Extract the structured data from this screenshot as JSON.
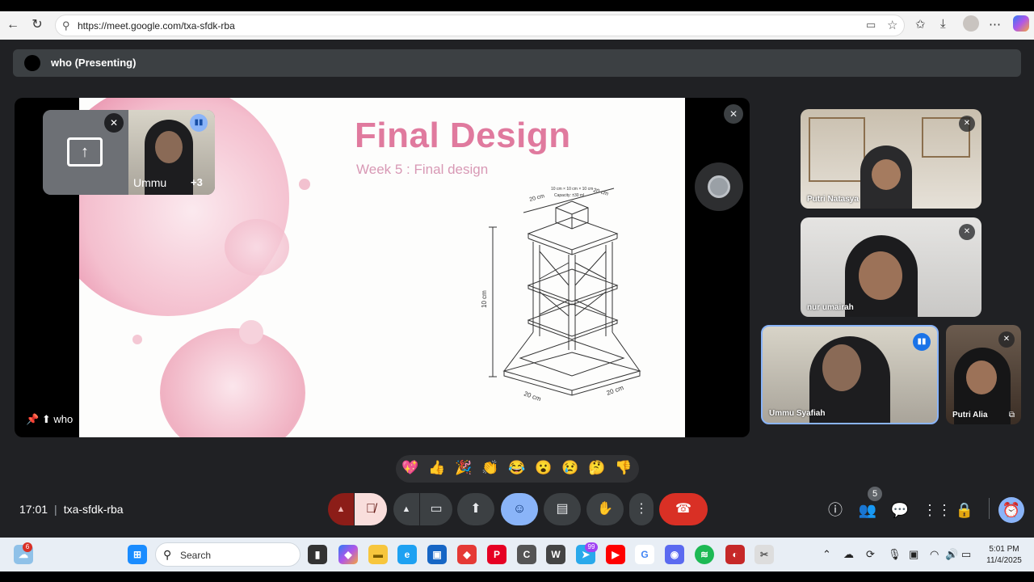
{
  "browser": {
    "url": "https://meet.google.com/txa-sfdk-rba"
  },
  "presenting_bar": {
    "label": "who (Presenting)"
  },
  "slide": {
    "title": "Final Design",
    "subtitle": "Week 5 : Final design",
    "diagram": {
      "top_dims": "20 cm",
      "top_note1": "10 cm × 10 cm × 10 cm",
      "top_note2": "Capacity: ±30 mL",
      "top_dims_right": "20 cm",
      "height_label": "10 cm",
      "base_left": "20 cm",
      "base_right": "20 cm"
    }
  },
  "stage": {
    "presenter_label": "who"
  },
  "pip": {
    "name": "Ummu",
    "others_count": "+3"
  },
  "participants": [
    {
      "name": "Putri Natasya"
    },
    {
      "name": "nur umairah"
    },
    {
      "name": "Ummu Syafiah"
    },
    {
      "name": "Putri Alia"
    }
  ],
  "reactions": [
    "💖",
    "👍",
    "🎉",
    "👏",
    "😂",
    "😮",
    "😢",
    "🤔",
    "👎"
  ],
  "meeting": {
    "time": "17:01",
    "code": "txa-sfdk-rba",
    "people_count": "5"
  },
  "colors": {
    "end_call": "#d93025",
    "mic_off": "#f9dedc",
    "emoji_active": "#8ab4f8",
    "slide_title": "#e07a9e"
  },
  "taskbar": {
    "search_label": "Search",
    "notification_count": "6",
    "telegram_count": "99",
    "clock_time": "5:01 PM",
    "clock_date": "11/4/2025"
  }
}
